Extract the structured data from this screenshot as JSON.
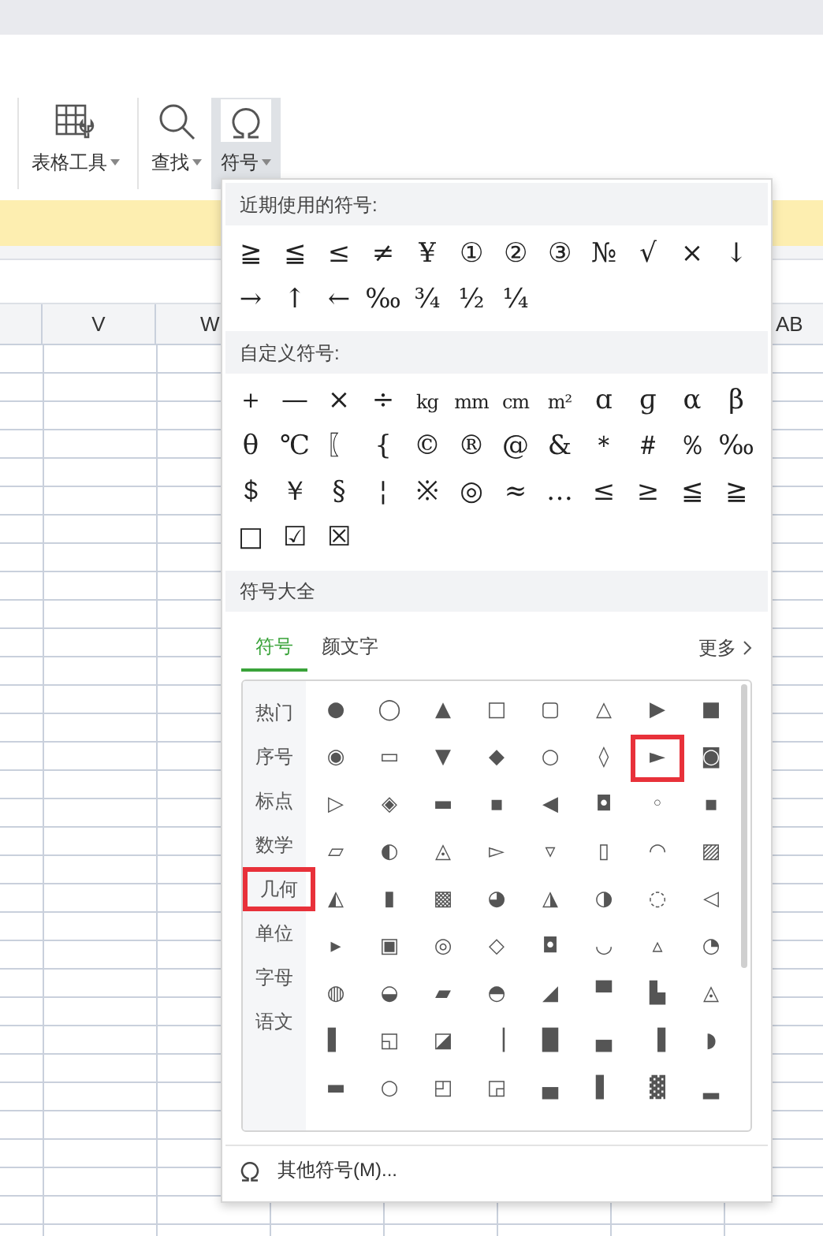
{
  "toolbar": {
    "buttons": [
      {
        "label": "表格工具",
        "selected": false
      },
      {
        "label": "查找",
        "selected": false
      },
      {
        "label": "符号",
        "selected": true
      }
    ]
  },
  "sheet": {
    "columns": [
      {
        "label": "V"
      },
      {
        "label": "W"
      },
      {
        "label": "AB"
      }
    ]
  },
  "symbol_menu": {
    "recent": {
      "title": "近期使用的符号:",
      "symbols": [
        "≧",
        "≦",
        "≤",
        "≠",
        "¥",
        "①",
        "②",
        "③",
        "№",
        "√",
        "×",
        "↓",
        "→",
        "↑",
        "←",
        "‰",
        "¾",
        "½",
        "¼"
      ]
    },
    "custom": {
      "title": "自定义符号:",
      "symbols": [
        "＋",
        "—",
        "×",
        "÷",
        "kg",
        "mm",
        "cm",
        "m²",
        "ɑ",
        "ɡ",
        "α",
        "β",
        "θ",
        "℃",
        "〖",
        "{",
        "©",
        "®",
        "@",
        "&",
        "＊",
        "＃",
        "％",
        "‰",
        "＄",
        "￥",
        "§",
        "¦",
        "※",
        "◎",
        "≈",
        "…",
        "≤",
        "≥",
        "≦",
        "≧",
        "□",
        "☑",
        "☒"
      ]
    },
    "all": {
      "title": "符号大全",
      "tabs": [
        {
          "label": "符号",
          "selected": true
        },
        {
          "label": "颜文字",
          "selected": false
        }
      ],
      "more": "更多",
      "categories": [
        {
          "label": "热门",
          "highlighted": false
        },
        {
          "label": "序号",
          "highlighted": false
        },
        {
          "label": "标点",
          "highlighted": false
        },
        {
          "label": "数学",
          "highlighted": false
        },
        {
          "label": "几何",
          "highlighted": true
        },
        {
          "label": "单位",
          "highlighted": false
        },
        {
          "label": "字母",
          "highlighted": false
        },
        {
          "label": "语文",
          "highlighted": false
        }
      ],
      "symbols": [
        {
          "char": "●",
          "highlighted": false
        },
        {
          "char": "◯",
          "highlighted": false
        },
        {
          "char": "▲",
          "highlighted": false
        },
        {
          "char": "□",
          "highlighted": false
        },
        {
          "char": "▢",
          "highlighted": false
        },
        {
          "char": "△",
          "highlighted": false
        },
        {
          "char": "▶",
          "highlighted": false
        },
        {
          "char": "■",
          "highlighted": false
        },
        {
          "char": "◉",
          "highlighted": false
        },
        {
          "char": "▭",
          "highlighted": false
        },
        {
          "char": "▼",
          "highlighted": false
        },
        {
          "char": "◆",
          "highlighted": false
        },
        {
          "char": "○",
          "highlighted": false
        },
        {
          "char": "◊",
          "highlighted": false
        },
        {
          "char": "►",
          "highlighted": true
        },
        {
          "char": "◙",
          "highlighted": false
        },
        {
          "char": "▷",
          "highlighted": false
        },
        {
          "char": "◈",
          "highlighted": false
        },
        {
          "char": "▬",
          "highlighted": false
        },
        {
          "char": "▪",
          "highlighted": false
        },
        {
          "char": "◀",
          "highlighted": false
        },
        {
          "char": "◘",
          "highlighted": false
        },
        {
          "char": "◦",
          "highlighted": false
        },
        {
          "char": "▪",
          "highlighted": false
        },
        {
          "char": "▱",
          "highlighted": false
        },
        {
          "char": "◐",
          "highlighted": false
        },
        {
          "char": "◬",
          "highlighted": false
        },
        {
          "char": "▻",
          "highlighted": false
        },
        {
          "char": "▿",
          "highlighted": false
        },
        {
          "char": "▯",
          "highlighted": false
        },
        {
          "char": "◠",
          "highlighted": false
        },
        {
          "char": "▨",
          "highlighted": false
        },
        {
          "char": "◭",
          "highlighted": false
        },
        {
          "char": "▮",
          "highlighted": false
        },
        {
          "char": "▩",
          "highlighted": false
        },
        {
          "char": "◕",
          "highlighted": false
        },
        {
          "char": "◮",
          "highlighted": false
        },
        {
          "char": "◑",
          "highlighted": false
        },
        {
          "char": "◌",
          "highlighted": false
        },
        {
          "char": "◁",
          "highlighted": false
        },
        {
          "char": "▸",
          "highlighted": false
        },
        {
          "char": "▣",
          "highlighted": false
        },
        {
          "char": "◎",
          "highlighted": false
        },
        {
          "char": "◇",
          "highlighted": false
        },
        {
          "char": "◘",
          "highlighted": false
        },
        {
          "char": "◡",
          "highlighted": false
        },
        {
          "char": "▵",
          "highlighted": false
        },
        {
          "char": "◔",
          "highlighted": false
        },
        {
          "char": "◍",
          "highlighted": false
        },
        {
          "char": "◒",
          "highlighted": false
        },
        {
          "char": "▰",
          "highlighted": false
        },
        {
          "char": "◓",
          "highlighted": false
        },
        {
          "char": "◢",
          "highlighted": false
        },
        {
          "char": "▀",
          "highlighted": false
        },
        {
          "char": "▙",
          "highlighted": false
        },
        {
          "char": "◬",
          "highlighted": false
        },
        {
          "char": "▌",
          "highlighted": false
        },
        {
          "char": "◱",
          "highlighted": false
        },
        {
          "char": "◪",
          "highlighted": false
        },
        {
          "char": "▕",
          "highlighted": false
        },
        {
          "char": "█",
          "highlighted": false
        },
        {
          "char": "▄",
          "highlighted": false
        },
        {
          "char": "▐",
          "highlighted": false
        },
        {
          "char": "◗",
          "highlighted": false
        },
        {
          "char": "▬",
          "highlighted": false
        },
        {
          "char": "○",
          "highlighted": false
        },
        {
          "char": "◰",
          "highlighted": false
        },
        {
          "char": "◲",
          "highlighted": false
        },
        {
          "char": "▄",
          "highlighted": false
        },
        {
          "char": "▌",
          "highlighted": false
        },
        {
          "char": "▓",
          "highlighted": false
        },
        {
          "char": "▂",
          "highlighted": false
        }
      ]
    },
    "footer": {
      "label": "其他符号(M)..."
    }
  }
}
